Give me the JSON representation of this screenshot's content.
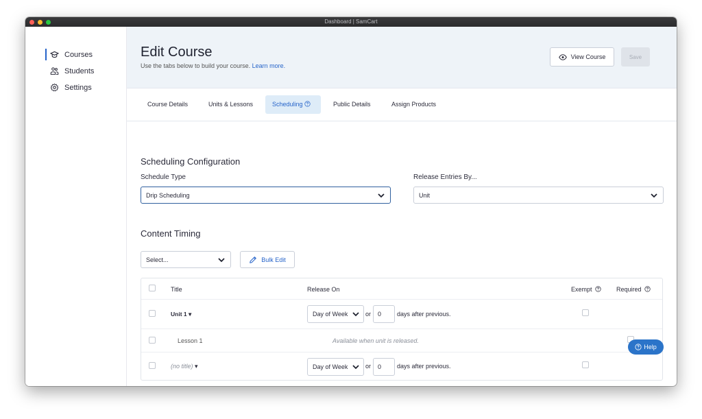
{
  "window": {
    "title": "Dashboard | SamCart"
  },
  "sidebar": {
    "items": [
      {
        "label": "Courses",
        "icon": "graduation-cap-icon",
        "active": true
      },
      {
        "label": "Students",
        "icon": "users-icon",
        "active": false
      },
      {
        "label": "Settings",
        "icon": "gear-icon",
        "active": false
      }
    ]
  },
  "header": {
    "title": "Edit Course",
    "subtitle": "Use the tabs below to build your course.",
    "learn_more": "Learn more.",
    "view_course": "View Course",
    "save": "Save"
  },
  "tabs": [
    {
      "label": "Course Details",
      "active": false
    },
    {
      "label": "Units & Lessons",
      "active": false
    },
    {
      "label": "Scheduling",
      "active": true
    },
    {
      "label": "Public Details",
      "active": false
    },
    {
      "label": "Assign Products",
      "active": false
    }
  ],
  "scheduling": {
    "section_title": "Scheduling Configuration",
    "schedule_type_label": "Schedule Type",
    "schedule_type_value": "Drip Scheduling",
    "release_by_label": "Release Entries By...",
    "release_by_value": "Unit"
  },
  "content_timing": {
    "section_title": "Content Timing",
    "select_placeholder": "Select...",
    "bulk_edit": "Bulk Edit",
    "columns": {
      "title": "Title",
      "release_on": "Release On",
      "exempt": "Exempt",
      "required": "Required"
    },
    "rows": [
      {
        "title": "Unit 1",
        "release_select": "Day of Week",
        "or": "or",
        "days": "0",
        "suffix": "days after previous."
      },
      {
        "title": "Lesson 1",
        "note": "Available when unit is released."
      },
      {
        "title": "(no title)",
        "release_select": "Day of Week",
        "or": "or",
        "days": "0",
        "suffix": "days after previous."
      }
    ]
  },
  "help": {
    "label": "Help"
  },
  "colors": {
    "accent": "#2563c9",
    "header_bg": "#eef3f8",
    "active_tab_bg": "#deecf8",
    "help_bg": "#2b74c9"
  }
}
